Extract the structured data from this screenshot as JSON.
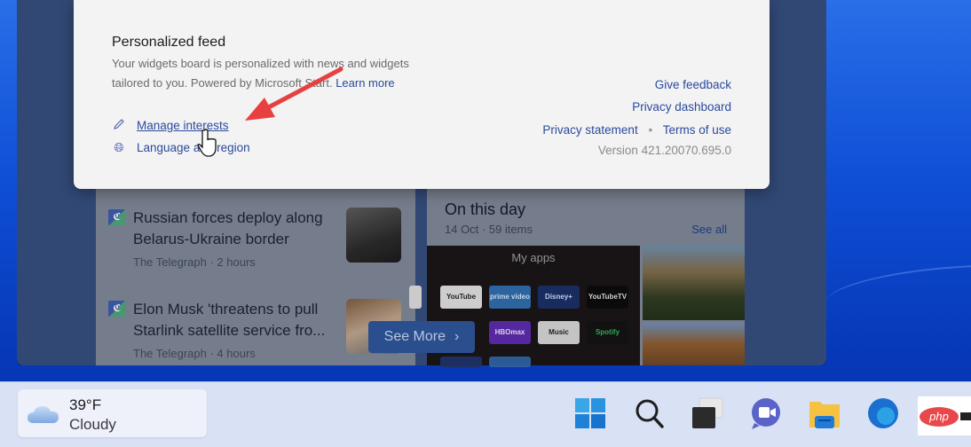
{
  "flyout": {
    "heading": "Personalized feed",
    "description": "Your widgets board is personalized with news and widgets tailored to you. Powered by Microsoft Start.",
    "learn_more": "Learn more",
    "manage_interests": "Manage interests",
    "language_region": "Language and region",
    "give_feedback": "Give feedback",
    "privacy_dashboard": "Privacy dashboard",
    "privacy_statement": "Privacy statement",
    "separator": "•",
    "terms_of_use": "Terms of use",
    "version": "Version 421.20070.695.0"
  },
  "news": [
    {
      "title": "Russian forces deploy along Belarus-Ukraine border",
      "source": "The Telegraph",
      "age": "2 hours",
      "meta": "The Telegraph · 2 hours"
    },
    {
      "title": "Elon Musk 'threatens to pull Starlink satellite service fro...",
      "source": "The Telegraph",
      "age": "4 hours",
      "meta": "The Telegraph · 4 hours"
    }
  ],
  "on_this_day": {
    "title": "On this day",
    "subtitle": "14 Oct · 59 items",
    "see_all": "See all",
    "photo_label": "My apps",
    "apps": [
      "YouTube",
      "prime video",
      "Disney+",
      "YouTubeTV",
      "HBOmax",
      "Music",
      "Spotify"
    ]
  },
  "see_more": "See More",
  "taskbar": {
    "weather": {
      "temp": "39°F",
      "condition": "Cloudy",
      "icon": "cloud-icon"
    },
    "icons": [
      "start-icon",
      "search-icon",
      "task-view-icon",
      "teams-chat-icon",
      "file-explorer-icon",
      "edge-icon"
    ]
  },
  "watermark": {
    "text": "php"
  },
  "colors": {
    "link": "#2b4a9c",
    "accent_arrow": "#e84040",
    "taskbar": "#d9e2f5"
  }
}
